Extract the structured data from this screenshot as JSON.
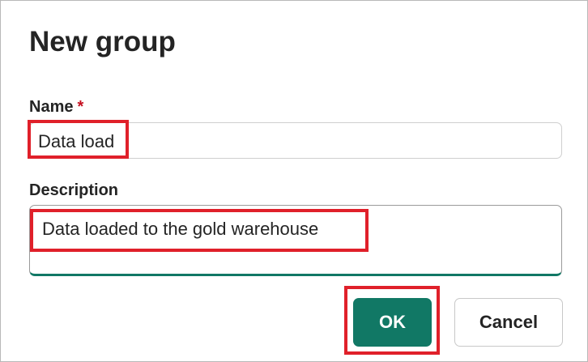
{
  "dialog": {
    "title": "New group"
  },
  "name_field": {
    "label": "Name",
    "required_marker": "*",
    "value": "Data load"
  },
  "description_field": {
    "label": "Description",
    "value": "Data loaded to the gold warehouse"
  },
  "buttons": {
    "ok_label": "OK",
    "cancel_label": "Cancel"
  },
  "colors": {
    "primary": "#117865",
    "required": "#c50f1f",
    "highlight": "#e0202a",
    "text": "#242424"
  }
}
